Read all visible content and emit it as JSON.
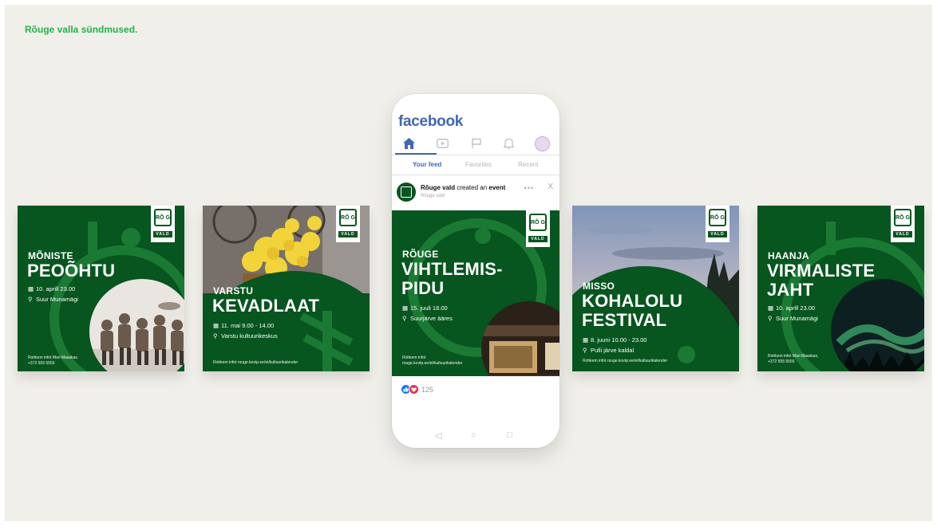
{
  "page": {
    "title": "Rõuge valla sündmused."
  },
  "logo": {
    "mark": "RÕ G",
    "word": "VALD"
  },
  "posters": [
    {
      "pre": "MÕNISTE",
      "title_lines": [
        "PEOÕHTU"
      ],
      "date": "10. aprill 23.00",
      "place": "Suur Munamägi",
      "foot_lines": [
        "Rohkem infot Mari Maaskas",
        "+372 555 5555"
      ]
    },
    {
      "pre": "VARSTU",
      "title_lines": [
        "KEVADLAAT"
      ],
      "date": "11. mai 9.00 - 14.00",
      "place": "Varstu kultuurikeskus",
      "foot_lines": [
        "Rohkem infot rouge.kovtp.ee/et/kultuurikalender"
      ]
    },
    {
      "pre": "RÕUGE",
      "title_lines": [
        "VIHTLEMIS-",
        "PIDU"
      ],
      "date": "15. juuli 18.00",
      "place": "Suurjärve ääres",
      "foot_lines": [
        "Rohkem infot",
        "rouge.kovtp.ee/et/kultuurikalender"
      ]
    },
    {
      "pre": "MISSO",
      "title_lines": [
        "KOHALOLU",
        "FESTIVAL"
      ],
      "date": "8. juuni 10.00 - 23.00",
      "place": "Pulli järve kaldal",
      "foot_lines": [
        "Rohkem infot rouge.kovtp.ee/et/kultuurikalender"
      ]
    },
    {
      "pre": "HAANJA",
      "title_lines": [
        "VIRMALISTE",
        "JAHT"
      ],
      "date": "10. aprill 23.00",
      "place": "Suur Munamägi",
      "foot_lines": [
        "Rohkem infot Mari Maaskas,",
        "+372 555 5555"
      ]
    }
  ],
  "phone": {
    "app_name": "facebook",
    "tabs": [
      "Your feed",
      "Favorites",
      "Recent"
    ],
    "post": {
      "author": "Rõuge vald",
      "action_mid": " created an ",
      "action_obj": "event",
      "subtitle": "Rõuge vald",
      "more": "•••",
      "close": "X"
    },
    "reaction_count": "125"
  },
  "icons": {
    "home": "home-icon",
    "video": "video-icon",
    "flag": "flag-icon",
    "bell": "bell-icon",
    "calendar": "calendar-icon",
    "pin": "pin-icon"
  },
  "colors": {
    "poster_green": "#07551f",
    "accent_green": "#1a7a33",
    "facebook_blue": "#4267b2",
    "title_green": "#22b24c",
    "background": "#f0efe9"
  }
}
